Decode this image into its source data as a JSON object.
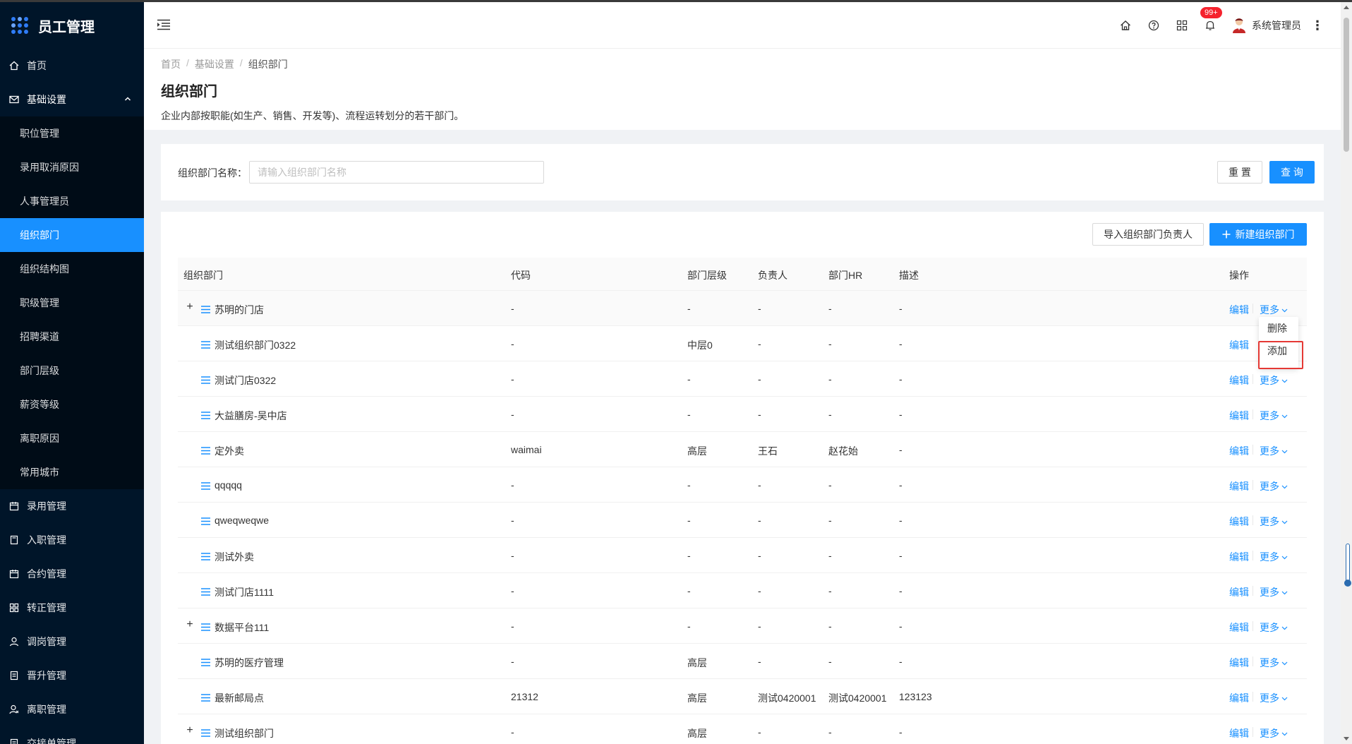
{
  "app": {
    "title": "员工管理"
  },
  "sidebar": {
    "items": [
      {
        "label": "首页",
        "icon": "home-icon"
      },
      {
        "label": "基础设置",
        "icon": "mail-icon",
        "open": true
      },
      {
        "label": "录用管理",
        "icon": "calendar-icon"
      },
      {
        "label": "入职管理",
        "icon": "document-icon"
      },
      {
        "label": "合约管理",
        "icon": "calendar-icon"
      },
      {
        "label": "转正管理",
        "icon": "grid-icon"
      },
      {
        "label": "调岗管理",
        "icon": "user-icon"
      },
      {
        "label": "晋升管理",
        "icon": "file-icon"
      },
      {
        "label": "离职管理",
        "icon": "user-leave-icon"
      },
      {
        "label": "交接单管理",
        "icon": "file-icon"
      }
    ],
    "submenu": [
      "职位管理",
      "录用取消原因",
      "人事管理员",
      "组织部门",
      "组织结构图",
      "职级管理",
      "招聘渠道",
      "部门层级",
      "薪资等级",
      "离职原因",
      "常用城市"
    ],
    "active_submenu": "组织部门"
  },
  "header": {
    "badge": "99+",
    "username": "系统管理员",
    "kebab": "⋮"
  },
  "breadcrumb": [
    "首页",
    "基础设置",
    "组织部门"
  ],
  "page": {
    "title": "组织部门",
    "description": "企业内部按职能(如生产、销售、开发等)、流程运转划分的若干部门。"
  },
  "search": {
    "label": "组织部门名称：",
    "placeholder": "请输入组织部门名称",
    "value": "",
    "reset_label": "重 置",
    "query_label": "查 询"
  },
  "toolbar": {
    "import_label": "导入组织部门负责人",
    "new_label": "新建组织部门"
  },
  "table": {
    "columns": [
      "组织部门",
      "代码",
      "部门层级",
      "负责人",
      "部门HR",
      "描述",
      "操作"
    ],
    "edit_label": "编辑",
    "more_label": "更多",
    "rows": [
      {
        "name": "苏明的门店",
        "code": "-",
        "level": "-",
        "owner": "-",
        "hr": "-",
        "desc": "-",
        "expandable": true
      },
      {
        "name": "测试组织部门0322",
        "code": "-",
        "level": "中层0",
        "owner": "-",
        "hr": "-",
        "desc": "-",
        "expandable": false
      },
      {
        "name": "测试门店0322",
        "code": "-",
        "level": "-",
        "owner": "-",
        "hr": "-",
        "desc": "-",
        "expandable": false
      },
      {
        "name": "大益膳房-吴中店",
        "code": "-",
        "level": "-",
        "owner": "-",
        "hr": "-",
        "desc": "-",
        "expandable": false
      },
      {
        "name": "定外卖",
        "code": "waimai",
        "level": "高层",
        "owner": "王石",
        "hr": "赵花始",
        "desc": "-",
        "expandable": false
      },
      {
        "name": "qqqqq",
        "code": "-",
        "level": "-",
        "owner": "-",
        "hr": "-",
        "desc": "-",
        "expandable": false
      },
      {
        "name": "qweqweqwe",
        "code": "-",
        "level": "-",
        "owner": "-",
        "hr": "-",
        "desc": "-",
        "expandable": false
      },
      {
        "name": "测试外卖",
        "code": "-",
        "level": "-",
        "owner": "-",
        "hr": "-",
        "desc": "-",
        "expandable": false
      },
      {
        "name": "测试门店1111",
        "code": "-",
        "level": "-",
        "owner": "-",
        "hr": "-",
        "desc": "-",
        "expandable": false
      },
      {
        "name": "数据平台111",
        "code": "-",
        "level": "-",
        "owner": "-",
        "hr": "-",
        "desc": "-",
        "expandable": true
      },
      {
        "name": "苏明的医疗管理",
        "code": "-",
        "level": "高层",
        "owner": "-",
        "hr": "-",
        "desc": "-",
        "expandable": false
      },
      {
        "name": "最新邮局点",
        "code": "21312",
        "level": "高层",
        "owner": "测试0420001",
        "hr": "测试0420001",
        "desc": "123123",
        "expandable": false
      },
      {
        "name": "测试组织部门",
        "code": "-",
        "level": "高层",
        "owner": "-",
        "hr": "-",
        "desc": "-",
        "expandable": true
      }
    ]
  },
  "dropdown": {
    "items": [
      "删除",
      "添加"
    ],
    "highlighted": "添加"
  },
  "colors": {
    "sidebar_bg": "#001529",
    "accent": "#1890ff",
    "highlight": "#e53935"
  }
}
